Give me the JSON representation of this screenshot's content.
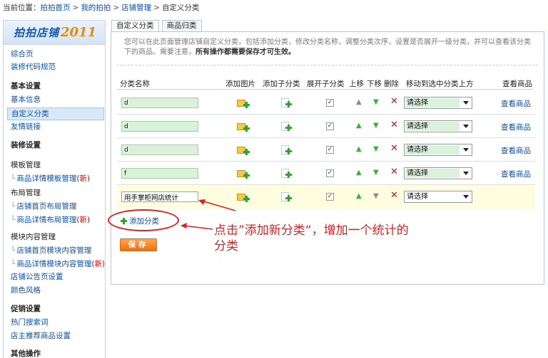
{
  "breadcrumb": {
    "prefix": "当前位置：",
    "items": [
      "拍拍首页",
      "我的拍拍",
      "店铺管理"
    ],
    "current": "自定义分类",
    "sep": ">"
  },
  "sidebar": {
    "logo_text": "拍拍店铺",
    "logo_year": "2011",
    "items": [
      {
        "label": "综合页",
        "kind": "link"
      },
      {
        "label": "装修代码规范",
        "kind": "link"
      },
      {
        "label": "基本设置",
        "kind": "head"
      },
      {
        "label": "基本信息",
        "kind": "link"
      },
      {
        "label": "自定义分类",
        "kind": "active"
      },
      {
        "label": "友情链接",
        "kind": "link"
      },
      {
        "label": "装修设置",
        "kind": "head"
      },
      {
        "label": "模板管理",
        "kind": "plain"
      },
      {
        "label": "商品详情模板管理",
        "kind": "sub",
        "new": "(新)"
      },
      {
        "label": "布局管理",
        "kind": "plain"
      },
      {
        "label": "店铺首页布局管理",
        "kind": "sub"
      },
      {
        "label": "商品详情布局管理",
        "kind": "sub",
        "new": "(新)"
      },
      {
        "label": "模块内容管理",
        "kind": "plain"
      },
      {
        "label": "店铺首页模块内容管理",
        "kind": "sub"
      },
      {
        "label": "商品详情模块内容管理",
        "kind": "sub",
        "new": "(新)"
      },
      {
        "label": "店铺公告页设置",
        "kind": "link"
      },
      {
        "label": "颜色风格",
        "kind": "link"
      },
      {
        "label": "促销设置",
        "kind": "head"
      },
      {
        "label": "热门搜索词",
        "kind": "link"
      },
      {
        "label": "店主推荐商品设置",
        "kind": "link"
      },
      {
        "label": "其他操作",
        "kind": "head"
      }
    ]
  },
  "tabs": [
    "自定义分类",
    "商品归类"
  ],
  "notice": {
    "text": "您可以在此页面管理店铺自定义分类，包括添加分类，修改分类名称，调整分类次序，设置是否展开一级分类，并可以查看该分类下的商品。需要注意，",
    "bold": "所有操作都需要保存才可生效。"
  },
  "table": {
    "headers": [
      "分类名称",
      "添加图片",
      "添加子分类",
      "展开子分类",
      "上移",
      "下移",
      "删除",
      "移动到选中分类上方",
      "查看商品"
    ],
    "rows": [
      {
        "name": "d",
        "select": "请选择",
        "view": "查看商品",
        "checked": "✓",
        "up_active": false,
        "down_active": true
      },
      {
        "name": "d",
        "select": "请选择",
        "view": "查看商品",
        "checked": "✓",
        "up_active": true,
        "down_active": true
      },
      {
        "name": "d",
        "select": "请选择",
        "view": "查看商品",
        "checked": "✓",
        "up_active": true,
        "down_active": true
      },
      {
        "name": "f",
        "select": "请选择",
        "view": "查看商品",
        "checked": "✓",
        "up_active": true,
        "down_active": true
      },
      {
        "name": "用手掌柜网店统计",
        "select": "请选择",
        "view": "",
        "checked": "✓",
        "up_active": true,
        "down_active": false
      }
    ]
  },
  "actions": {
    "add_category": "添加分类",
    "save": "保存"
  },
  "annotation": "点击”添加新分类“，增加一个统计的分类",
  "colors": {
    "link": "#0b4fa8",
    "annotation": "#e02020",
    "save_button": "#ee7010",
    "input_bg": "#d9f2d9",
    "highlight_row": "#fefde0"
  }
}
